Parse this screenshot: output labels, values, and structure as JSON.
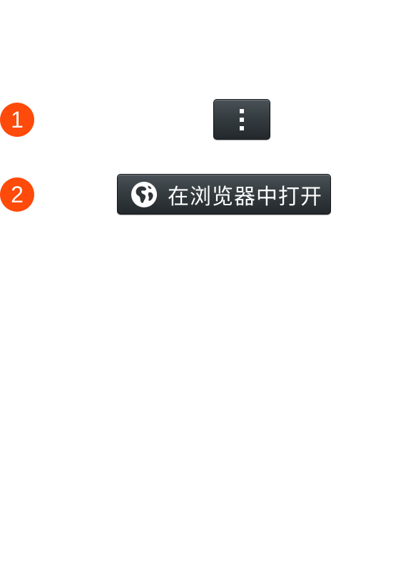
{
  "steps": [
    {
      "number": "1"
    },
    {
      "number": "2"
    }
  ],
  "menu_button": {
    "icon": "overflow-menu-icon"
  },
  "browser_button": {
    "icon": "globe-icon",
    "label": "在浏览器中打开"
  },
  "colors": {
    "badge": "#fe4a0a",
    "button_dark": "#2d3438",
    "button_text": "#ffffff",
    "background": "#ffffff"
  }
}
